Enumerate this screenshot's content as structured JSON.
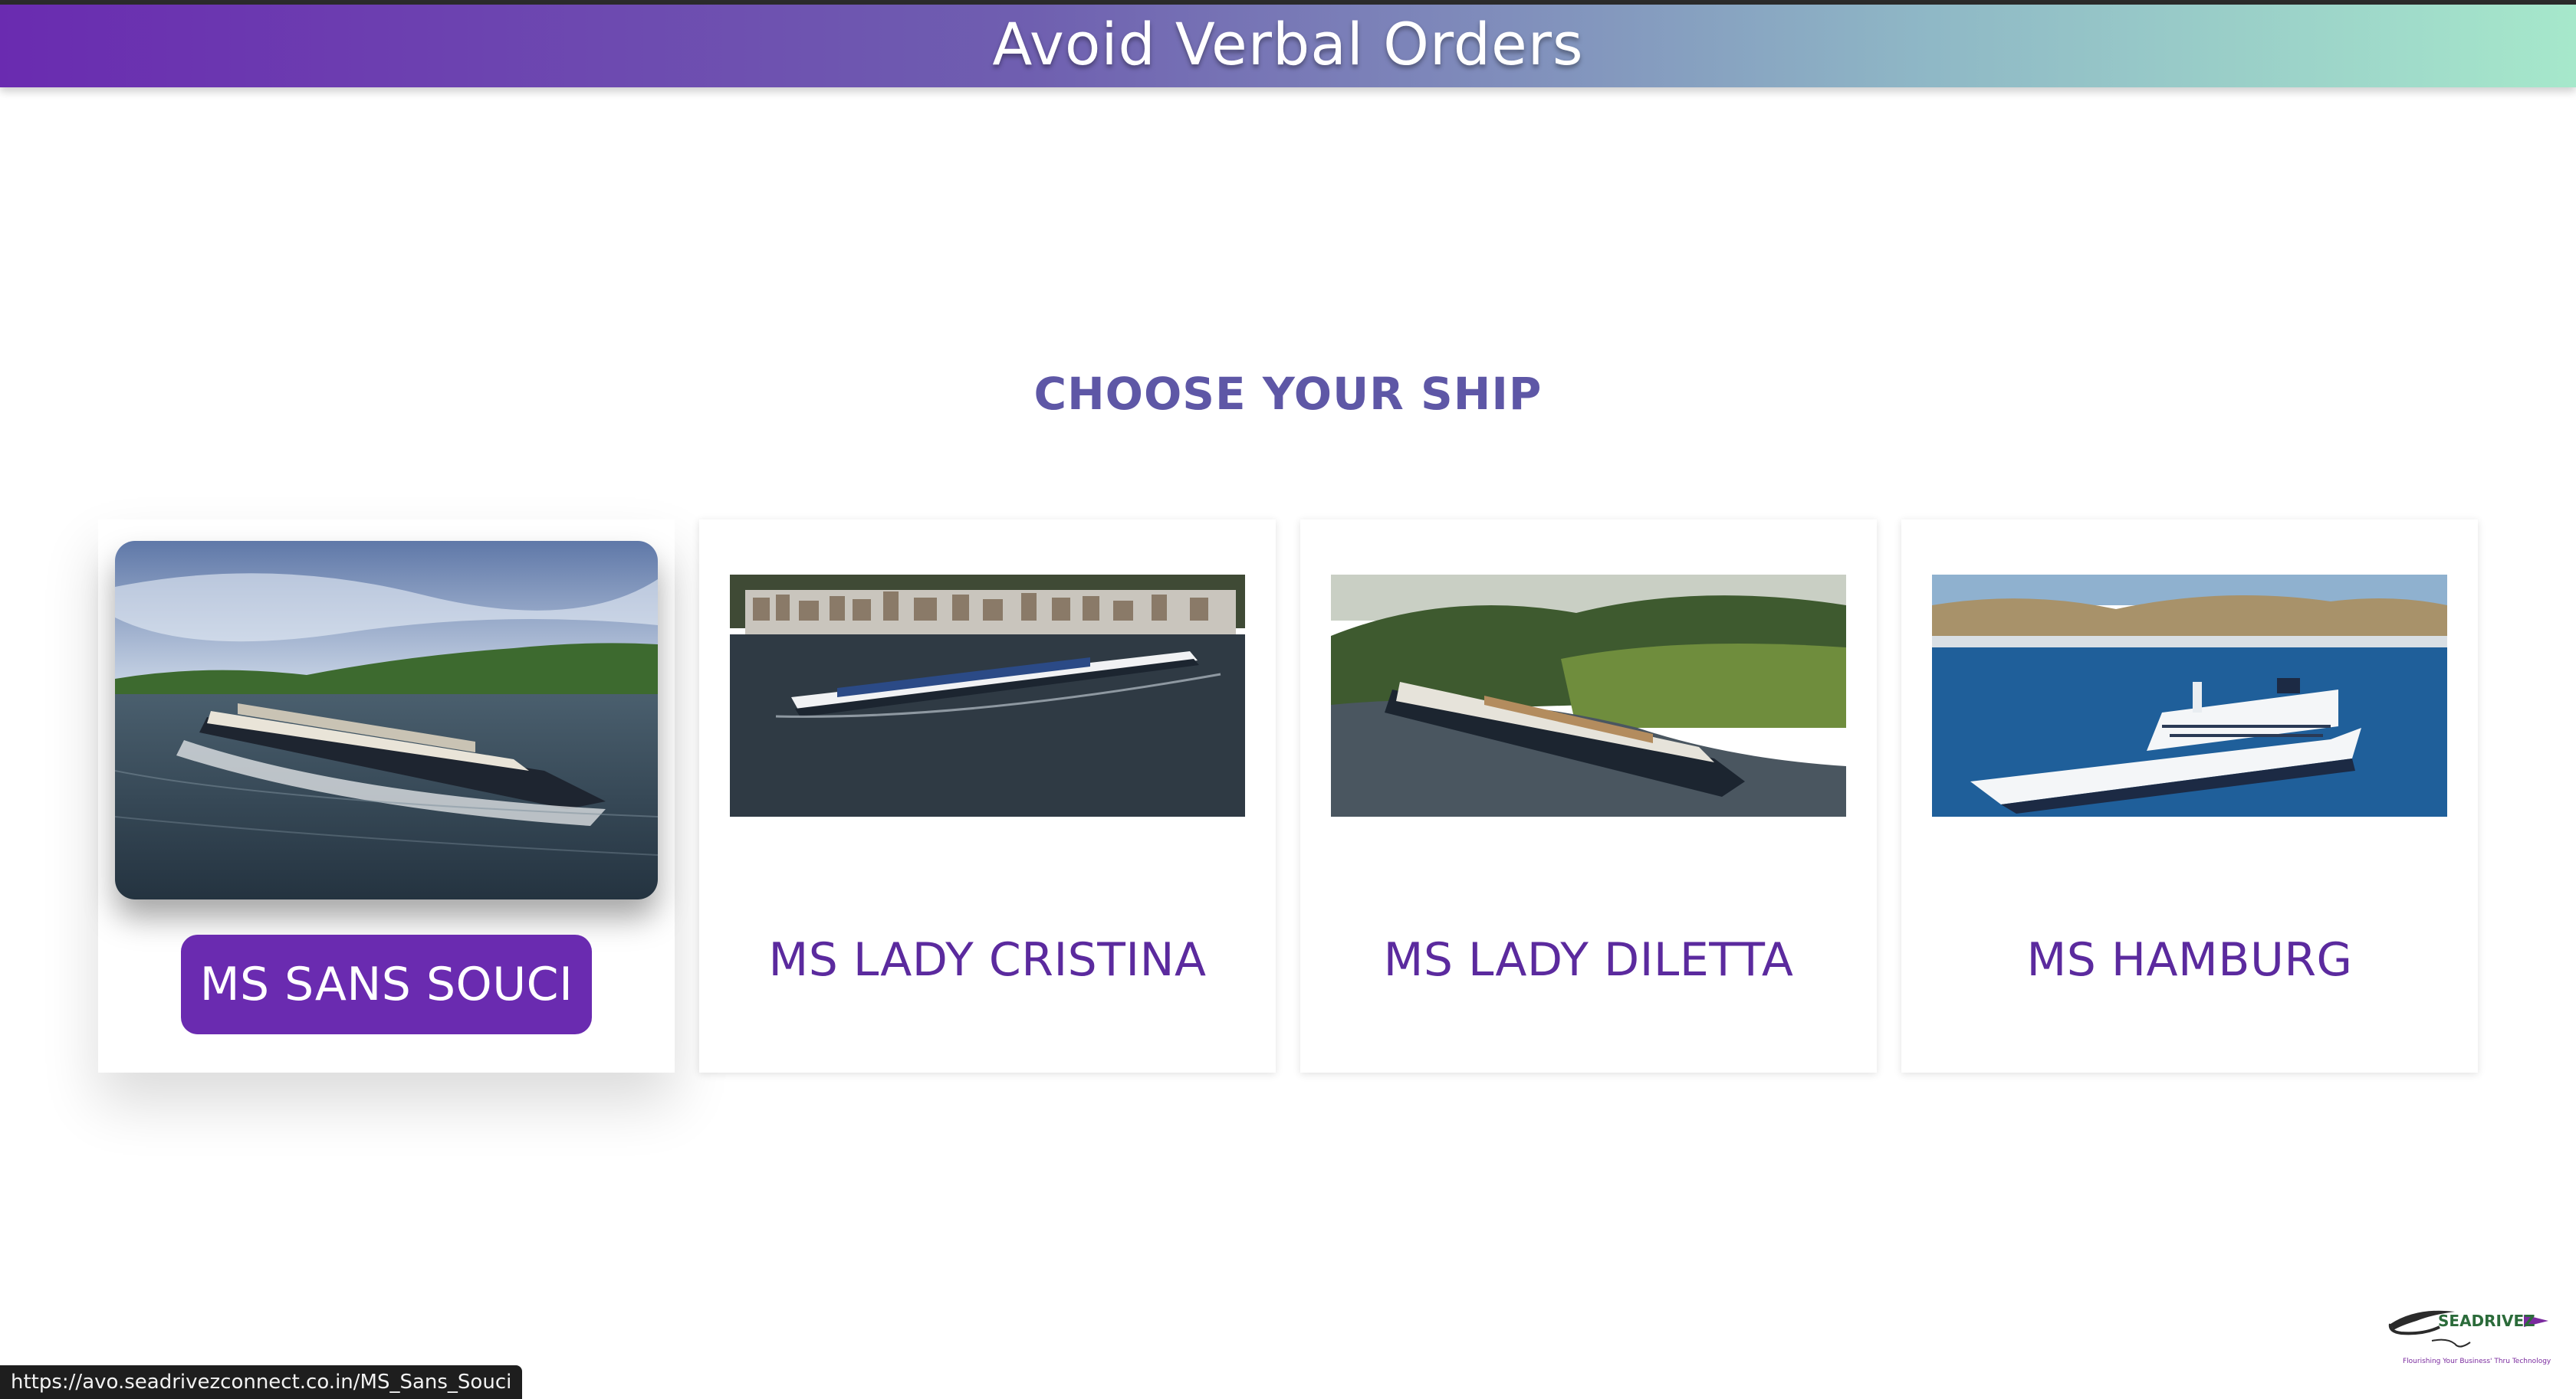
{
  "header": {
    "title": "Avoid Verbal Orders"
  },
  "main": {
    "section_title": "CHOOSE YOUR SHIP"
  },
  "ships": [
    {
      "name": "MS SANS SOUCI",
      "selected": true
    },
    {
      "name": "MS LADY CRISTINA",
      "selected": false
    },
    {
      "name": "MS LADY DILETTA",
      "selected": false
    },
    {
      "name": "MS HAMBURG",
      "selected": false
    }
  ],
  "statusbar": {
    "url": "https://avo.seadrivezconnect.co.in/MS_Sans_Souci"
  },
  "brand": {
    "name": "SEADRIVEZ",
    "tagline": "Flourishing Your Business' Thru Technology"
  },
  "colors": {
    "accent": "#6a2bb0",
    "title": "#5e57a6",
    "label": "#5b2a9e"
  }
}
